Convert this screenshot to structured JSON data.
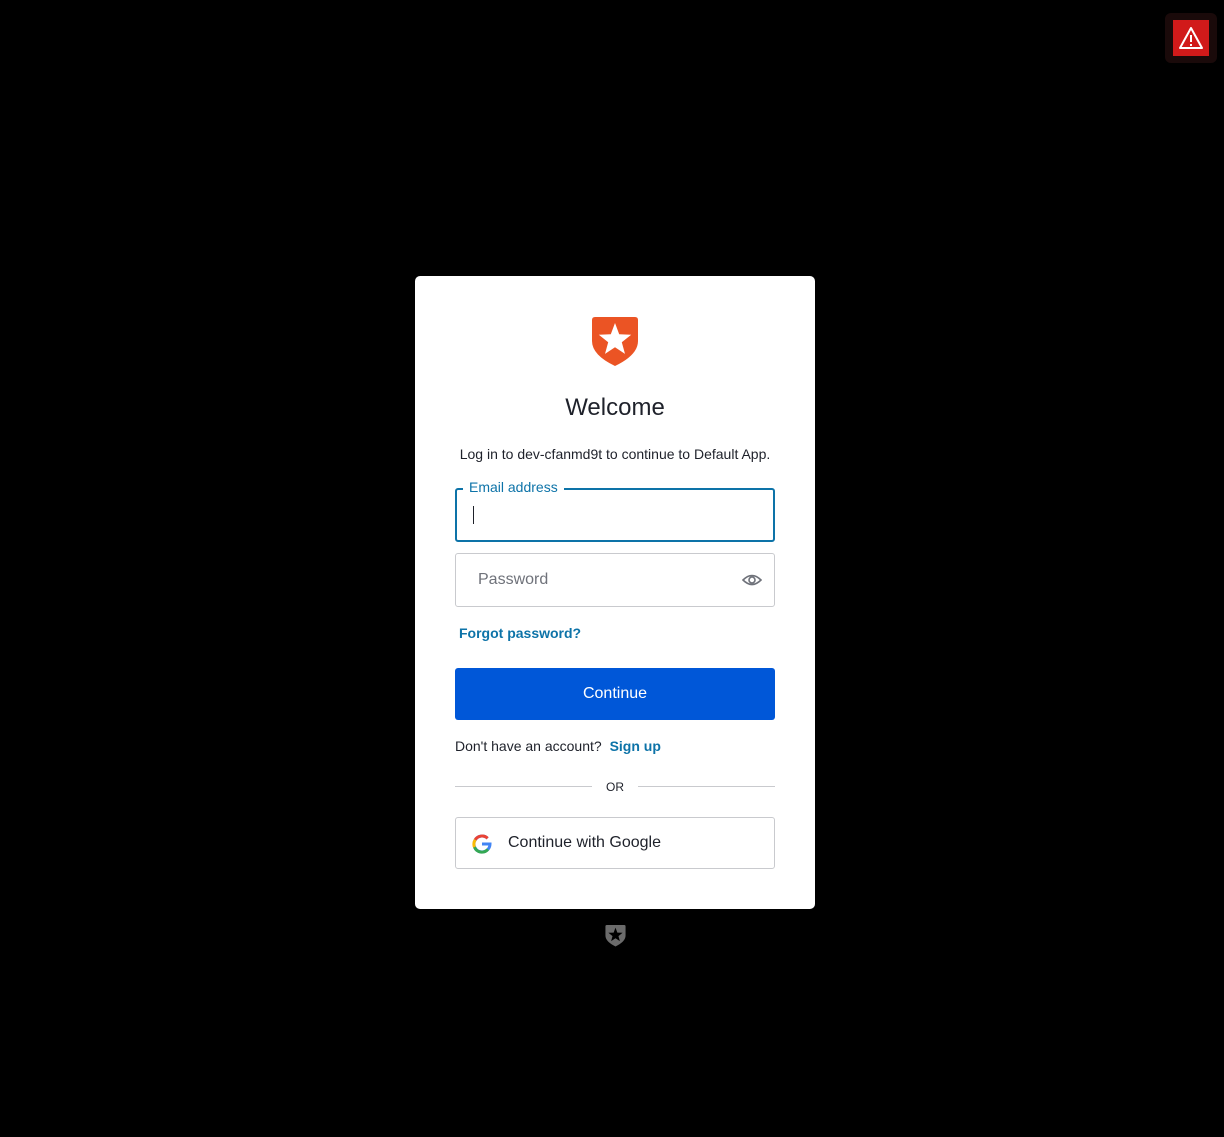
{
  "alert": {
    "icon": "warning-icon",
    "color": "#d11a1a"
  },
  "brand": {
    "logo": "auth0-shield-star-logo",
    "accent": "#eb5424"
  },
  "login": {
    "title": "Welcome",
    "subtitle": "Log in to dev-cfanmd9t to continue to Default App.",
    "email_label": "Email address",
    "email_value": "",
    "password_placeholder": "Password",
    "forgot_password": "Forgot password?",
    "continue_label": "Continue",
    "no_account_text": "Don't have an account?",
    "signup_label": "Sign up",
    "or_text": "OR",
    "google_label": "Continue with Google"
  },
  "colors": {
    "primary_button": "#0057d8",
    "link": "#0d73a8",
    "background": "#000000"
  },
  "footer": {
    "logo": "auth0-footer-logo"
  }
}
